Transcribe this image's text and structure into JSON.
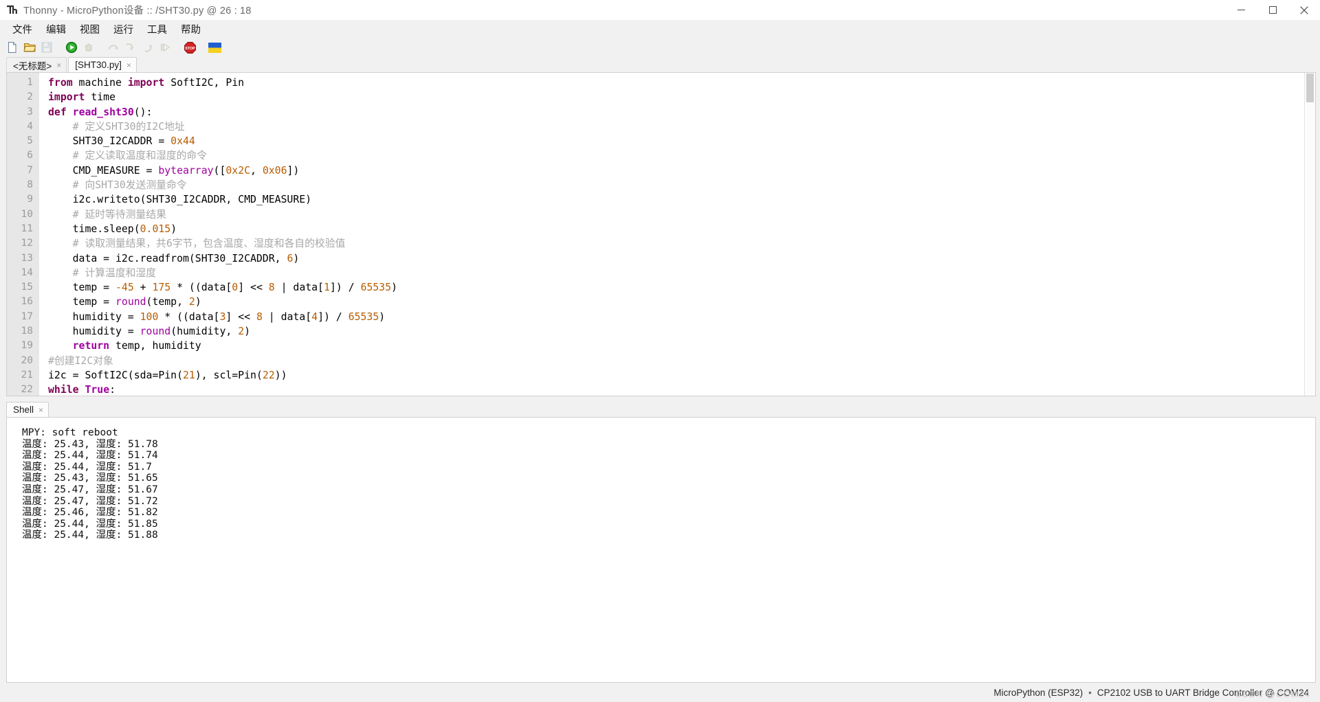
{
  "window": {
    "title": "Thonny  -  MicroPython设备 :: /SHT30.py @ 26 : 18",
    "app_icon": "thonny-icon",
    "minimize_label": "—",
    "maximize_label": "▢",
    "close_label": "✕"
  },
  "menu": {
    "items": [
      {
        "label": "文件",
        "name": "menu-file"
      },
      {
        "label": "编辑",
        "name": "menu-edit"
      },
      {
        "label": "视图",
        "name": "menu-view"
      },
      {
        "label": "运行",
        "name": "menu-run"
      },
      {
        "label": "工具",
        "name": "menu-tools"
      },
      {
        "label": "帮助",
        "name": "menu-help"
      }
    ]
  },
  "toolbar": {
    "buttons": [
      {
        "name": "new-file-icon",
        "enabled": true
      },
      {
        "name": "open-file-icon",
        "enabled": true
      },
      {
        "name": "save-file-icon",
        "enabled": false
      },
      {
        "name": "run-icon",
        "enabled": true
      },
      {
        "name": "debug-icon",
        "enabled": false
      },
      {
        "name": "step-over-icon",
        "enabled": false
      },
      {
        "name": "step-into-icon",
        "enabled": false
      },
      {
        "name": "step-out-icon",
        "enabled": false
      },
      {
        "name": "resume-icon",
        "enabled": false
      },
      {
        "name": "stop-icon",
        "enabled": true
      },
      {
        "name": "ukraine-flag-icon",
        "enabled": true
      }
    ]
  },
  "editor_tabs": [
    {
      "label": "<无标题>",
      "active": false,
      "close": "×",
      "name": "editor-tab-untitled"
    },
    {
      "label": "[SHT30.py]",
      "active": true,
      "close": "×",
      "name": "editor-tab-sht30"
    }
  ],
  "editor": {
    "line_numbers": [
      "1",
      "2",
      "3",
      "4",
      "5",
      "6",
      "7",
      "8",
      "9",
      "10",
      "11",
      "12",
      "13",
      "14",
      "15",
      "16",
      "17",
      "18",
      "19",
      "20",
      "21",
      "22"
    ],
    "lines": [
      [
        {
          "t": "from",
          "c": "kw"
        },
        {
          "t": " machine ",
          "c": ""
        },
        {
          "t": "import",
          "c": "kw"
        },
        {
          "t": " SoftI2C, Pin",
          "c": ""
        }
      ],
      [
        {
          "t": "import",
          "c": "kw"
        },
        {
          "t": " time",
          "c": ""
        }
      ],
      [
        {
          "t": "def",
          "c": "kw"
        },
        {
          "t": " ",
          "c": ""
        },
        {
          "t": "read_sht30",
          "c": "kw2"
        },
        {
          "t": "():",
          "c": ""
        }
      ],
      [
        {
          "t": "    # 定义SHT30的I2C地址",
          "c": "cm"
        }
      ],
      [
        {
          "t": "    SHT30_I2CADDR = ",
          "c": ""
        },
        {
          "t": "0x44",
          "c": "num"
        }
      ],
      [
        {
          "t": "    # 定义读取温度和湿度的命令",
          "c": "cm"
        }
      ],
      [
        {
          "t": "    CMD_MEASURE = ",
          "c": ""
        },
        {
          "t": "bytearray",
          "c": "bi"
        },
        {
          "t": "([",
          "c": ""
        },
        {
          "t": "0x2C",
          "c": "num"
        },
        {
          "t": ", ",
          "c": ""
        },
        {
          "t": "0x06",
          "c": "num"
        },
        {
          "t": "])",
          "c": ""
        }
      ],
      [
        {
          "t": "    # 向SHT30发送测量命令",
          "c": "cm"
        }
      ],
      [
        {
          "t": "    i2c.writeto(SHT30_I2CADDR, CMD_MEASURE)",
          "c": ""
        }
      ],
      [
        {
          "t": "    # 延时等待测量结果",
          "c": "cm"
        }
      ],
      [
        {
          "t": "    time.sleep(",
          "c": ""
        },
        {
          "t": "0.015",
          "c": "num"
        },
        {
          "t": ")",
          "c": ""
        }
      ],
      [
        {
          "t": "    # 读取测量结果，共6字节，包含温度、湿度和各自的校验值",
          "c": "cm"
        }
      ],
      [
        {
          "t": "    data = i2c.readfrom(SHT30_I2CADDR, ",
          "c": ""
        },
        {
          "t": "6",
          "c": "num"
        },
        {
          "t": ")",
          "c": ""
        }
      ],
      [
        {
          "t": "    # 计算温度和湿度",
          "c": "cm"
        }
      ],
      [
        {
          "t": "    temp = ",
          "c": ""
        },
        {
          "t": "-45",
          "c": "num"
        },
        {
          "t": " + ",
          "c": ""
        },
        {
          "t": "175",
          "c": "num"
        },
        {
          "t": " * ((data[",
          "c": ""
        },
        {
          "t": "0",
          "c": "num"
        },
        {
          "t": "] << ",
          "c": ""
        },
        {
          "t": "8",
          "c": "num"
        },
        {
          "t": " | data[",
          "c": ""
        },
        {
          "t": "1",
          "c": "num"
        },
        {
          "t": "]) / ",
          "c": ""
        },
        {
          "t": "65535",
          "c": "num"
        },
        {
          "t": ")",
          "c": ""
        }
      ],
      [
        {
          "t": "    temp = ",
          "c": ""
        },
        {
          "t": "round",
          "c": "bi"
        },
        {
          "t": "(temp, ",
          "c": ""
        },
        {
          "t": "2",
          "c": "num"
        },
        {
          "t": ")",
          "c": ""
        }
      ],
      [
        {
          "t": "    humidity = ",
          "c": ""
        },
        {
          "t": "100",
          "c": "num"
        },
        {
          "t": " * ((data[",
          "c": ""
        },
        {
          "t": "3",
          "c": "num"
        },
        {
          "t": "] << ",
          "c": ""
        },
        {
          "t": "8",
          "c": "num"
        },
        {
          "t": " | data[",
          "c": ""
        },
        {
          "t": "4",
          "c": "num"
        },
        {
          "t": "]) / ",
          "c": ""
        },
        {
          "t": "65535",
          "c": "num"
        },
        {
          "t": ")",
          "c": ""
        }
      ],
      [
        {
          "t": "    humidity = ",
          "c": ""
        },
        {
          "t": "round",
          "c": "bi"
        },
        {
          "t": "(humidity, ",
          "c": ""
        },
        {
          "t": "2",
          "c": "num"
        },
        {
          "t": ")",
          "c": ""
        }
      ],
      [
        {
          "t": "    ",
          "c": ""
        },
        {
          "t": "return",
          "c": "kw2"
        },
        {
          "t": " temp, humidity",
          "c": ""
        }
      ],
      [
        {
          "t": "#创建I2C对象",
          "c": "cm"
        }
      ],
      [
        {
          "t": "i2c = SoftI2C(sda=Pin(",
          "c": ""
        },
        {
          "t": "21",
          "c": "num"
        },
        {
          "t": "), scl=Pin(",
          "c": ""
        },
        {
          "t": "22",
          "c": "num"
        },
        {
          "t": "))",
          "c": ""
        }
      ],
      [
        {
          "t": "while",
          "c": "kw"
        },
        {
          "t": " ",
          "c": ""
        },
        {
          "t": "True",
          "c": "kw2"
        },
        {
          "t": ":",
          "c": ""
        }
      ]
    ]
  },
  "shell_tabs": [
    {
      "label": "Shell",
      "active": true,
      "close": "×",
      "name": "shell-tab"
    }
  ],
  "shell": {
    "lines": [
      "MPY: soft reboot",
      "温度: 25.43, 湿度: 51.78",
      "温度: 25.44, 湿度: 51.74",
      "温度: 25.44, 湿度: 51.7",
      "温度: 25.43, 湿度: 51.65",
      "温度: 25.47, 湿度: 51.67",
      "温度: 25.47, 湿度: 51.72",
      "温度: 25.46, 湿度: 51.82",
      "温度: 25.44, 湿度: 51.85",
      "温度: 25.44, 湿度: 51.88"
    ]
  },
  "statusbar": {
    "interpreter": "MicroPython (ESP32)",
    "separator": "•",
    "device": "CP2102 USB to UART Bridge Controller @ COM24"
  },
  "watermark": "CSDN @COM24",
  "colors": {
    "keyword": "#7f0055",
    "builtin": "#a000a0",
    "number": "#b85c00",
    "comment": "#a8a8a8",
    "gutter_bg": "#e7e7e7",
    "chrome_bg": "#f1f1f1",
    "editor_bg": "#ffffff"
  }
}
